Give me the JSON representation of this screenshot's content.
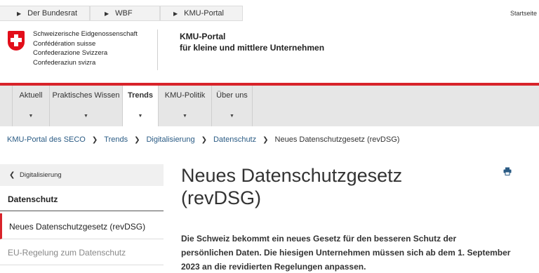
{
  "top_breadcrumb": [
    "Der Bundesrat",
    "WBF",
    "KMU-Portal"
  ],
  "startseite": "Startseite",
  "confederation_names": [
    "Schweizerische Eidgenossenschaft",
    "Confédération suisse",
    "Confederazione Svizzera",
    "Confederaziun svizra"
  ],
  "portal": {
    "title_line1": "KMU-Portal",
    "title_line2": "für kleine und mittlere Unternehmen"
  },
  "nav_tabs": [
    {
      "label": "Aktuell"
    },
    {
      "label": "Praktisches Wissen"
    },
    {
      "label": "Trends",
      "active": true
    },
    {
      "label": "KMU-Politik"
    },
    {
      "label": "Über uns"
    }
  ],
  "breadcrumb": [
    "KMU-Portal des SECO",
    "Trends",
    "Digitalisierung",
    "Datenschutz"
  ],
  "breadcrumb_current": "Neues Datenschutzgesetz (revDSG)",
  "sidebar": {
    "back_label": "Digitalisierung",
    "heading": "Datenschutz",
    "items": [
      {
        "label": "Neues Datenschutzgesetz (revDSG)",
        "active": true
      },
      {
        "label": "EU-Regelung zum Datenschutz",
        "active": false
      }
    ]
  },
  "main": {
    "title": "Neues Datenschutzgesetz (revDSG)",
    "lead": "Die Schweiz bekommt ein neues Gesetz für den besseren Schutz der persönlichen Daten. Die hiesigen Unternehmen müssen sich ab dem 1. September 2023 an die revidierten Regelungen anpassen."
  },
  "colors": {
    "accent_red": "#d8232a",
    "link_blue": "#2a5b84",
    "nav_bg": "#e6e6e6"
  },
  "icons": {
    "print": "print-icon",
    "back": "chevron-left-icon"
  }
}
